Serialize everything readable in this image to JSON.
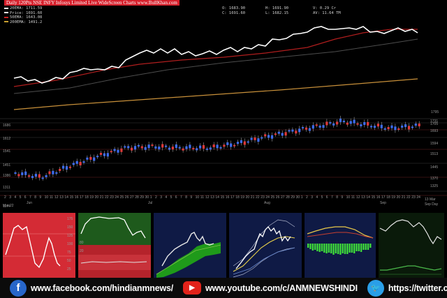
{
  "header": {
    "title": "Daily 120Pts NSE INFY Infosys Limited Live WideScreen Charts www.BullKhan.com",
    "legend": [
      {
        "text": "20EMA: 1711.59",
        "color": "#ffffff"
      },
      {
        "text": "Price: 1691.60",
        "color": "#ffffff"
      },
      {
        "text": "50EMA: 1643.08",
        "color": "#c81e1e"
      },
      {
        "text": "200EMA: 1491.2",
        "color": "#c8a030"
      }
    ],
    "ohlc": [
      "O: 1683.90",
      "C: 1691.60"
    ],
    "hilo": [
      "H: 1691.90",
      "L: 1682.15"
    ],
    "stats": [
      "V: 0.29 Cr",
      "AV: 11.64 TM"
    ]
  },
  "upper_chart": {
    "price_label": "1795",
    "series_colors": {
      "price": "#ffffff",
      "ema50": "#c81e1e",
      "ema20": "#5a5a5a",
      "ema200": "#c8903a"
    }
  },
  "candle_chart": {
    "right_levels": [
      "1731",
      "1705",
      "1693",
      "1594",
      "1513",
      "1445",
      "1370",
      "1325"
    ],
    "left_levels": [
      "1686",
      "1612",
      "1541",
      "1451",
      "1386",
      "1311",
      "1174"
    ],
    "months": [
      "Jun",
      "Jul",
      "Aug",
      "Sep"
    ],
    "corner_left": "Mar 22",
    "corner_right": [
      "13 Mar",
      "Sep Day"
    ]
  },
  "mini_panels": [
    {
      "name": "rsi",
      "bg": "#d42b35",
      "labels": [
        "175",
        "150",
        "125",
        "100",
        "75",
        "50",
        "25"
      ]
    },
    {
      "name": "stochastic",
      "bg": "#1e5a1c",
      "labels": [
        "80",
        "20"
      ]
    },
    {
      "name": "ichimoku",
      "bg": "#0f1a45"
    },
    {
      "name": "bollinger",
      "bg": "#0f1a45"
    },
    {
      "name": "macd",
      "bg": "#0f1a45"
    },
    {
      "name": "adx",
      "bg": "#0a1a0a"
    }
  ],
  "social": [
    {
      "icon": "facebook-icon",
      "glyph": "f",
      "label": "www.facebook.com/hindianmnews/"
    },
    {
      "icon": "youtube-icon",
      "glyph": "▶",
      "label": "www.youtube.com/c/ANMNEWSHINDI"
    },
    {
      "icon": "twitter-icon",
      "glyph": "🐦",
      "label": "https://twitter.com/anmnews"
    }
  ]
}
